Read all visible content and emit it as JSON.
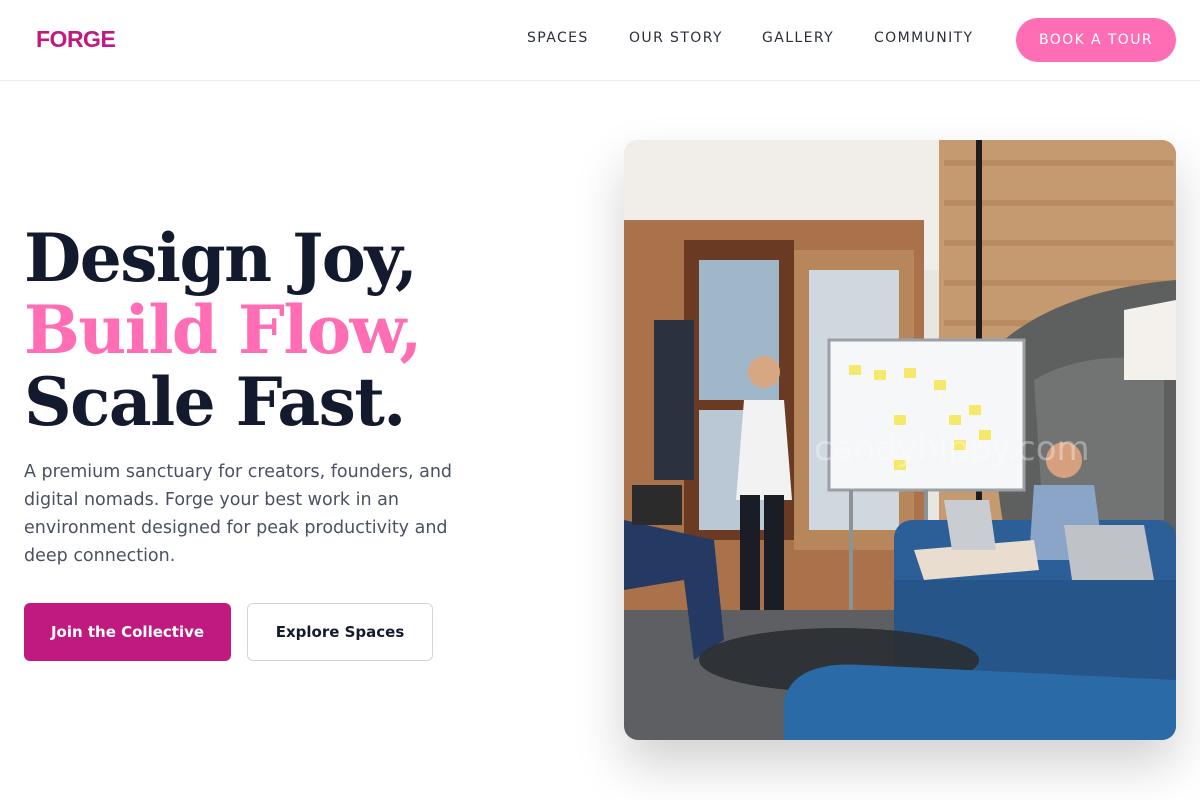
{
  "brand": {
    "logo": "FORGE",
    "accent": "#c0197f",
    "highlight": "#ff6eb4"
  },
  "nav": {
    "items": [
      {
        "label": "SPACES"
      },
      {
        "label": "OUR STORY"
      },
      {
        "label": "GALLERY"
      },
      {
        "label": "COMMUNITY"
      }
    ],
    "cta": "BOOK A TOUR"
  },
  "hero": {
    "headline": [
      "Design Joy,",
      "Build Flow,",
      "Scale Fast."
    ],
    "subtext": "A premium sanctuary for creators, founders, and digital nomads. Forge your best work in an environment designed for peak productivity and deep connection.",
    "primary_button": "Join the Collective",
    "secondary_button": "Explore Spaces",
    "image": {
      "description_icon": "coworking-photo",
      "watermark": "candyhippy.com"
    }
  }
}
